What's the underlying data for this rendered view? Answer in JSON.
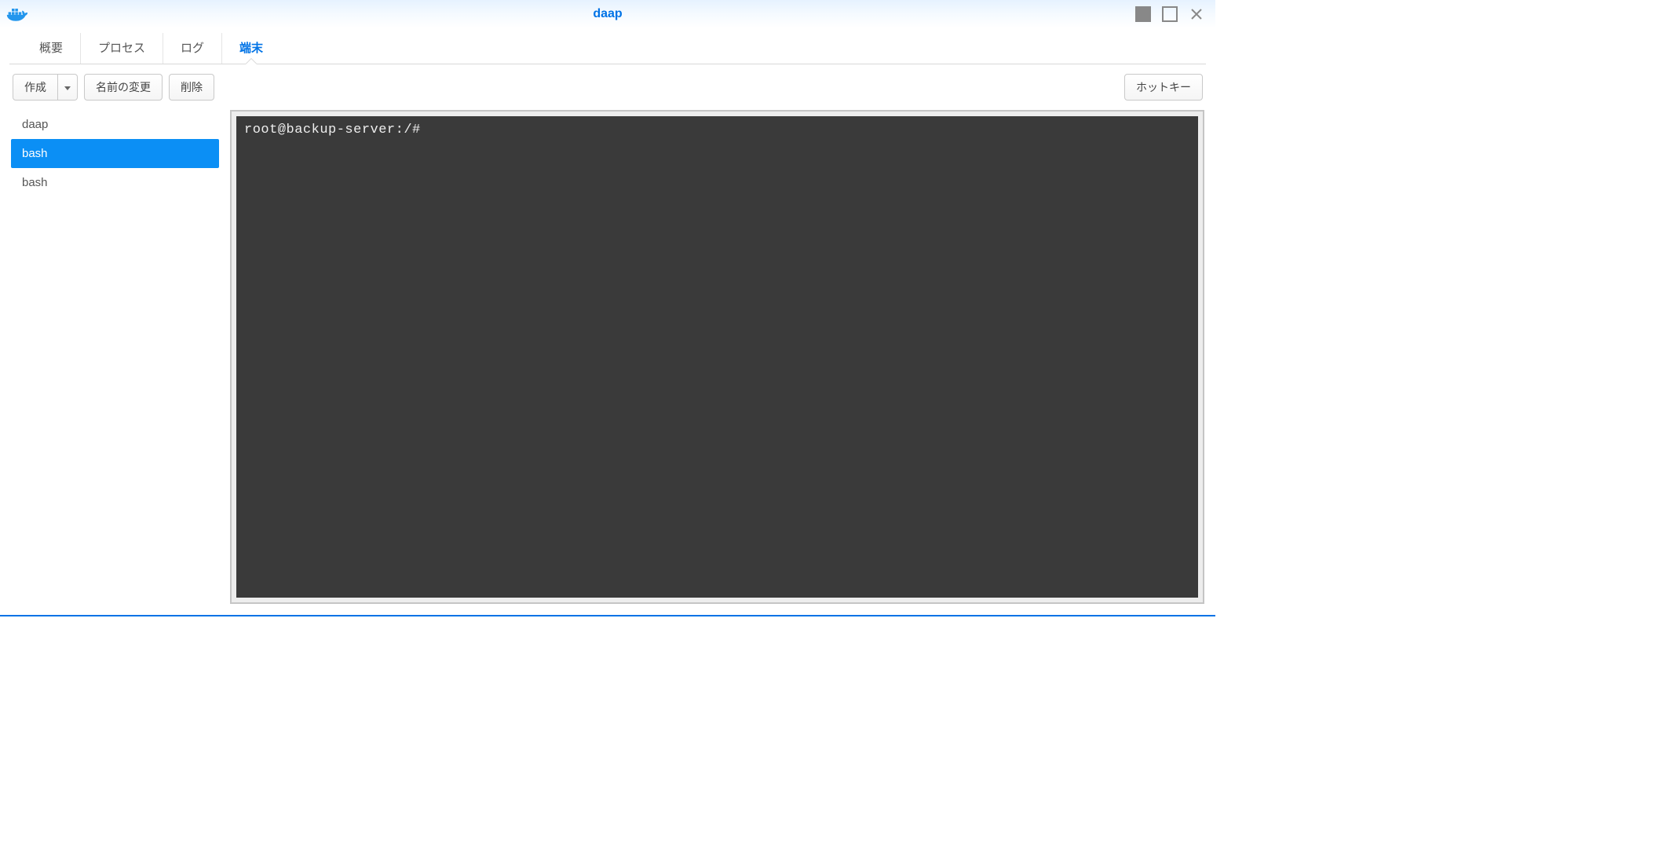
{
  "window": {
    "title": "daap"
  },
  "tabs": [
    {
      "label": "概要",
      "active": false
    },
    {
      "label": "プロセス",
      "active": false
    },
    {
      "label": "ログ",
      "active": false
    },
    {
      "label": "端末",
      "active": true
    }
  ],
  "toolbar": {
    "create_label": "作成",
    "rename_label": "名前の変更",
    "delete_label": "削除",
    "hotkey_label": "ホットキー"
  },
  "sidebar": {
    "items": [
      {
        "label": "daap",
        "selected": false
      },
      {
        "label": "bash",
        "selected": true
      },
      {
        "label": "bash",
        "selected": false
      }
    ]
  },
  "terminal": {
    "content": "root@backup-server:/#"
  }
}
